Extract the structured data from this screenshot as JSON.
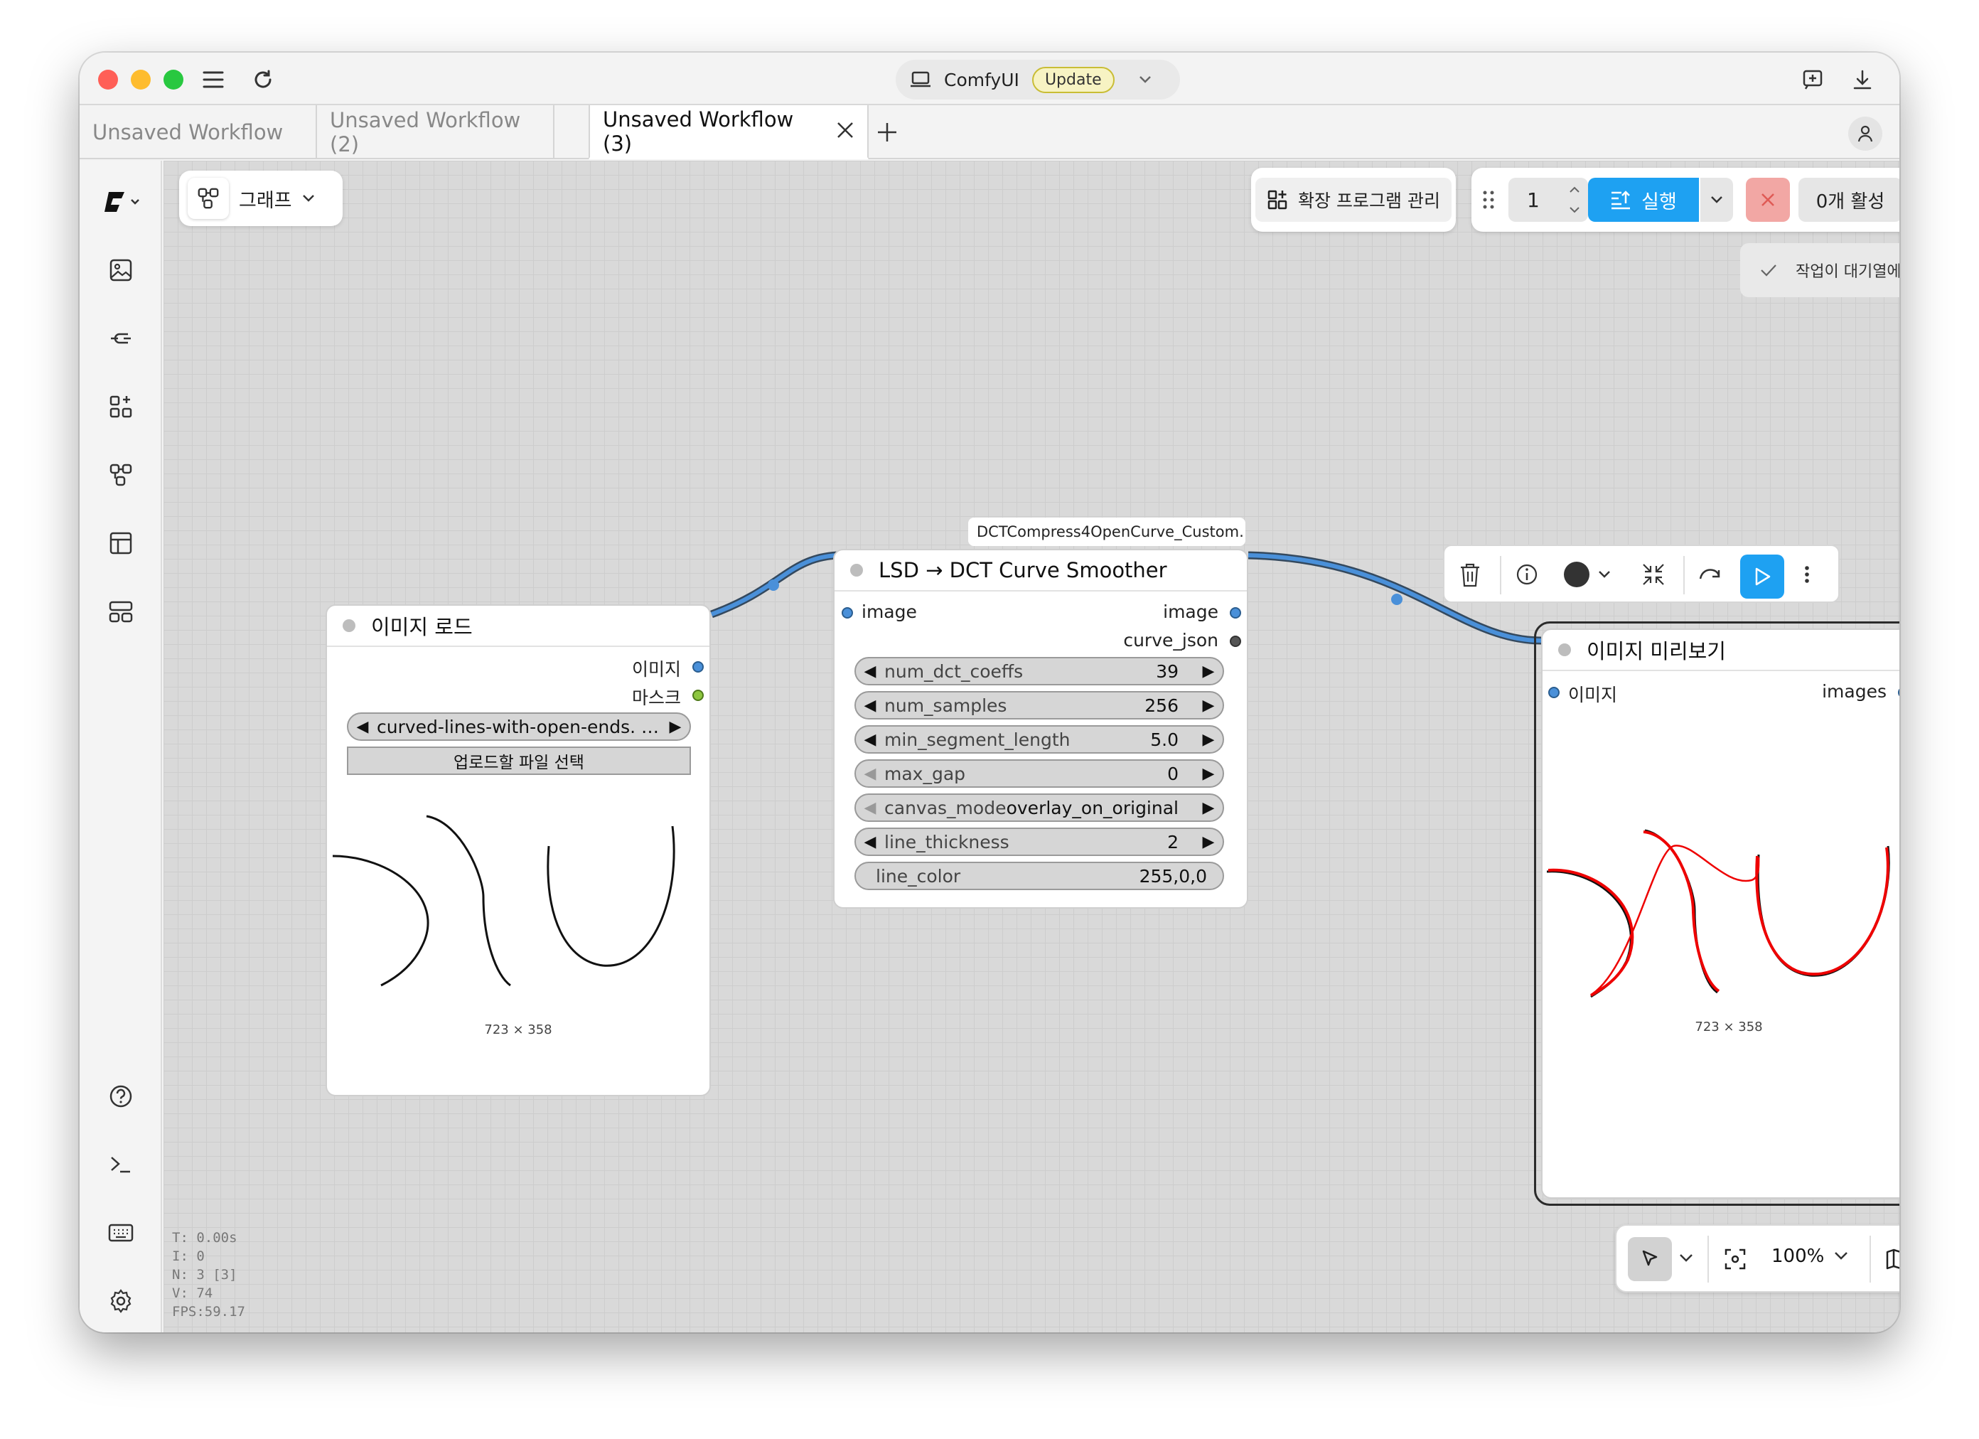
{
  "titlebar": {
    "app_name": "ComfyUI",
    "update_label": "Update"
  },
  "tabs": [
    {
      "label": "Unsaved Workflow"
    },
    {
      "label": "Unsaved Workflow (2)"
    },
    {
      "label": "Unsaved Workflow (3)"
    }
  ],
  "topbar": {
    "graph_label": "그래프",
    "extensions_label": "확장 프로그램 관리",
    "batch_count": "1",
    "run_label": "실행",
    "active_count_label": "0개 활성",
    "toast": "작업이 대기열에 추가됨"
  },
  "nodes": {
    "load_image": {
      "title": "이미지 로드",
      "outputs": [
        "이미지",
        "마스크"
      ],
      "file_value": "curved-lines-with-open-ends. …",
      "upload_label": "업로드할 파일 선택",
      "dimensions": "723 × 358"
    },
    "dct": {
      "badge": "DCTCompress4OpenCurve_Custom…",
      "title": "LSD → DCT Curve Smoother",
      "input": "image",
      "outputs": [
        "image",
        "curve_json"
      ],
      "widgets": [
        {
          "name": "num_dct_coeffs",
          "value": "39"
        },
        {
          "name": "num_samples",
          "value": "256"
        },
        {
          "name": "min_segment_length",
          "value": "5.0"
        },
        {
          "name": "max_gap",
          "value": "0"
        },
        {
          "name": "canvas_mode",
          "value": "overlay_on_original"
        },
        {
          "name": "line_thickness",
          "value": "2"
        },
        {
          "name": "line_color",
          "value": "255,0,0"
        }
      ]
    },
    "preview": {
      "title": "이미지 미리보기",
      "input": "이미지",
      "output": "images",
      "dimensions": "723 × 358"
    }
  },
  "stats": {
    "t": "T: 0.00s",
    "i": "I: 0",
    "n": "N: 3 [3]",
    "v": "V: 74",
    "fps": "FPS:59.17"
  },
  "bottom_toolbar": {
    "zoom": "100%"
  },
  "colors": {
    "accent": "#1ea1f2",
    "link": "#4a90d9",
    "cancel": "#f2a7a4"
  }
}
